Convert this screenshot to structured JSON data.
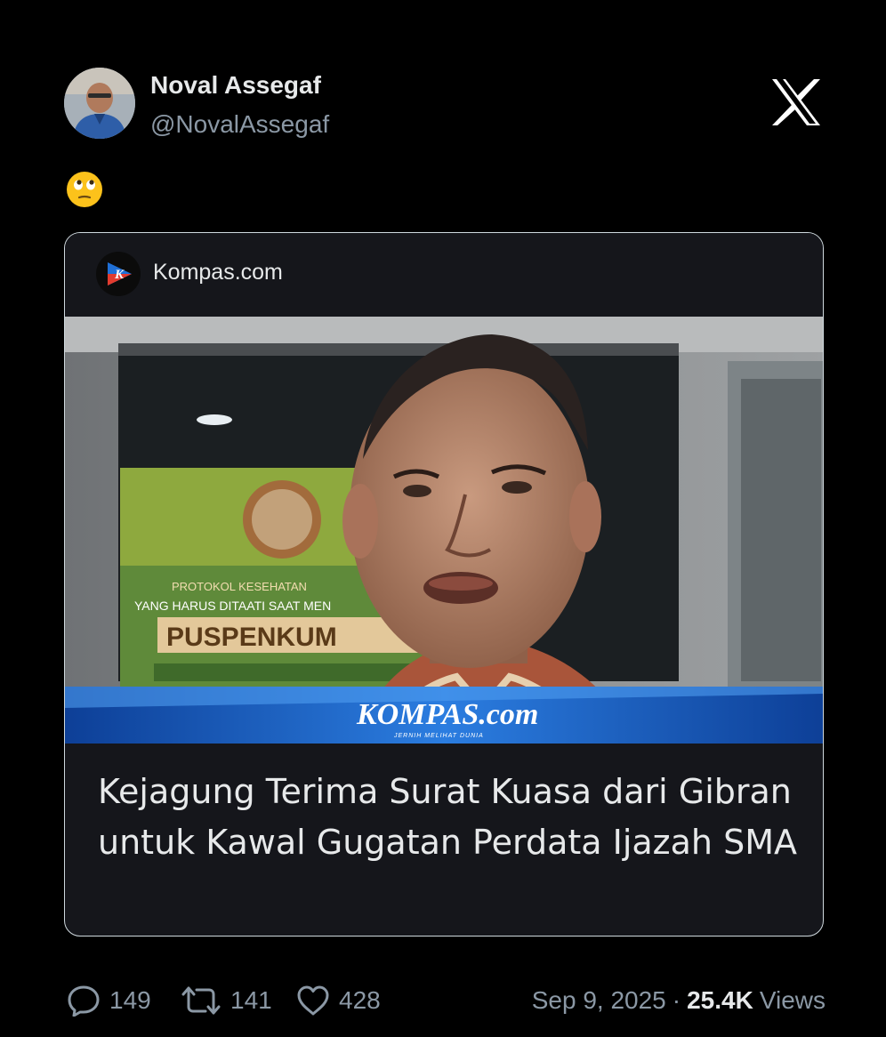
{
  "author": {
    "name": "Noval Assegaf",
    "handle": "@NovalAssegaf",
    "avatar_icon": "avatar-photo"
  },
  "platform": {
    "logo_icon": "x-logo-icon"
  },
  "tweet": {
    "emoji_icon": "face-with-rolling-eyes-emoji"
  },
  "card": {
    "source_name": "Kompas.com",
    "source_logo_icon": "kompas-k-logo-icon",
    "image_caption_logo": "KOMPAS.com",
    "image_caption_tagline": "JERNIH MELIHAT DUNIA",
    "image_sign_text": "PUSPENKUM",
    "headline": "Kejagung Terima Surat Kuasa dari Gibran untuk Kawal Gugatan Perdata Ijazah SMA"
  },
  "actions": {
    "replies": "149",
    "retweets": "141",
    "likes": "428"
  },
  "meta": {
    "date": "Sep 9, 2025",
    "separator": "·",
    "views_count": "25.4K",
    "views_label": "Views"
  },
  "colors": {
    "background": "#000000",
    "primary_text": "#e7e9ea",
    "secondary_text": "#8b98a5",
    "card_border": "#cfd9de",
    "card_background": "#15161b",
    "kompas_blue": "#1f6fd6"
  }
}
